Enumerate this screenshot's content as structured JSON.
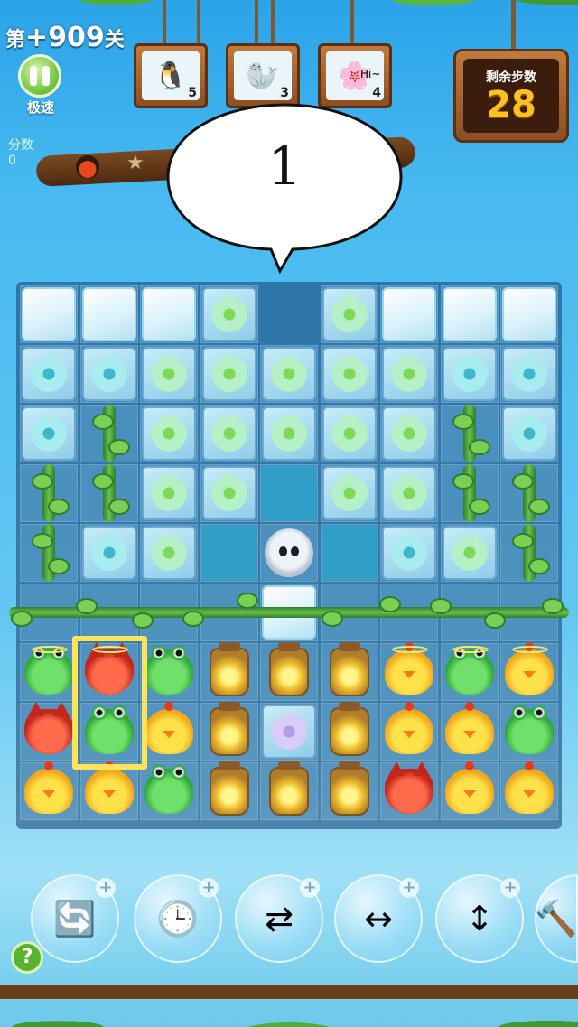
{
  "header": {
    "level_prefix": "第",
    "level_number": "+909",
    "level_suffix": "关",
    "speed_label": "极速",
    "score_label": "分数",
    "score_value": "0"
  },
  "goals": [
    {
      "icon": "penguin-icon",
      "glyph": "🐧",
      "count": "5"
    },
    {
      "icon": "seal-icon",
      "glyph": "🦭",
      "count": "3"
    },
    {
      "icon": "flower-cube-icon",
      "glyph": "🌸",
      "count": "4",
      "caption": "Hi~"
    }
  ],
  "moves": {
    "label": "剩余步数",
    "value": "28"
  },
  "speech_bubble": {
    "text": "1"
  },
  "board": {
    "columns": 9,
    "rows": 9,
    "grid": [
      [
        "ice",
        "ice",
        "ice",
        "flower",
        "empty",
        "flower",
        "ice",
        "ice",
        "ice"
      ],
      [
        "flower-blue",
        "flower-blue",
        "flower",
        "flower",
        "flower",
        "flower",
        "flower",
        "flower-blue",
        "flower-blue"
      ],
      [
        "flower-blue",
        "vine",
        "flower",
        "flower",
        "flower",
        "flower",
        "flower",
        "vine",
        "flower-blue"
      ],
      [
        "vine",
        "vine",
        "flower",
        "flower",
        "hole",
        "flower",
        "flower",
        "vine",
        "vine"
      ],
      [
        "vine",
        "flower-blue",
        "flower",
        "hole",
        "creature",
        "hole",
        "flower-blue",
        "flower",
        "vine"
      ],
      [
        "bg",
        "bg",
        "bg",
        "bg",
        "ice",
        "bg",
        "bg",
        "bg",
        "bg"
      ],
      [
        "frog",
        "fox",
        "frog",
        "jar",
        "jar",
        "jar",
        "chick",
        "frog",
        "chick"
      ],
      [
        "fox",
        "frog",
        "chick",
        "jar",
        "flower-purple",
        "jar",
        "chick",
        "chick",
        "frog"
      ],
      [
        "chick",
        "chick",
        "frog",
        "jar",
        "jar",
        "jar",
        "fox",
        "chick",
        "chick"
      ]
    ],
    "haloed_cells": [
      [
        6,
        0
      ],
      [
        6,
        1
      ],
      [
        6,
        6
      ],
      [
        6,
        7
      ],
      [
        6,
        8
      ]
    ],
    "selected_cells": [
      [
        6,
        1
      ],
      [
        7,
        1
      ]
    ]
  },
  "boosters": [
    {
      "icon": "shuffle-board-icon",
      "glyph": "🔄"
    },
    {
      "icon": "clock-icon",
      "glyph": "🕒"
    },
    {
      "icon": "swap-icon",
      "glyph": "⇄"
    },
    {
      "icon": "horizontal-rocket-icon",
      "glyph": "↔"
    },
    {
      "icon": "vertical-rocket-icon",
      "glyph": "↕"
    },
    {
      "icon": "hammer-icon",
      "glyph": "🔨"
    }
  ],
  "help_label": "?"
}
